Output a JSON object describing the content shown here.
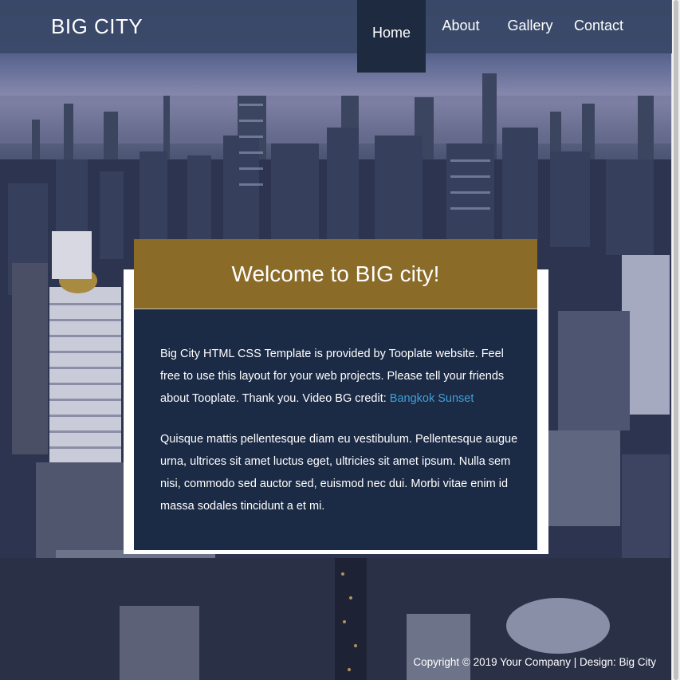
{
  "header": {
    "brand": "BIG CITY",
    "nav": [
      {
        "label": "Home",
        "active": true
      },
      {
        "label": "About",
        "active": false
      },
      {
        "label": "Gallery",
        "active": false
      },
      {
        "label": "Contact",
        "active": false
      }
    ]
  },
  "welcome": {
    "title": "Welcome to BIG city!",
    "paragraph1_text": "Big City HTML CSS Template is provided by Tooplate website. Feel free to use this layout for your web projects. Please tell your friends about Tooplate. Thank you. Video BG credit: ",
    "paragraph1_link": "Bangkok Sunset",
    "paragraph2": "Quisque mattis pellentesque diam eu vestibulum. Pellentesque augue urna, ultrices sit amet luctus eget, ultricies sit amet ipsum. Nulla sem nisi, commodo sed auctor sed, euismod nec dui. Morbi vitae enim id massa sodales tincidunt a et mi."
  },
  "footer": {
    "copyright": "Copyright © 2019 Your Company | Design: Big City"
  },
  "colors": {
    "header_bg": "#3a4867",
    "nav_active_bg": "#1e2a40",
    "title_bar_bg": "#8b6b28",
    "panel_bg": "#1b2a45",
    "link": "#3ea0d8"
  }
}
